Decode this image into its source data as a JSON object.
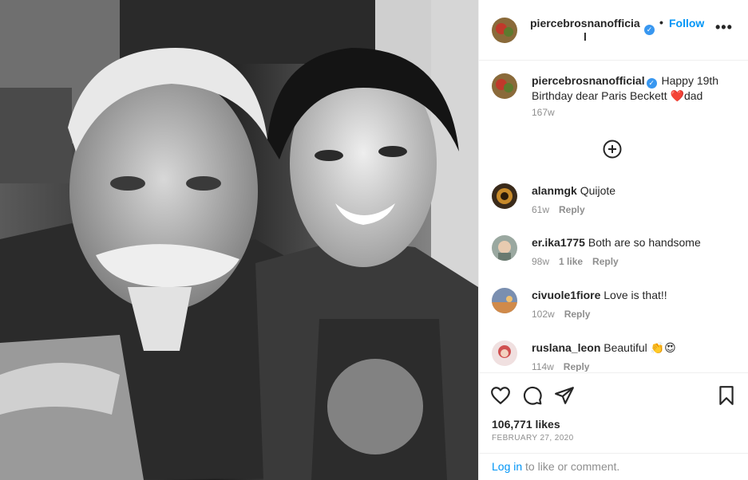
{
  "colors": {
    "accent": "#0095f6",
    "verified": "#3897f0",
    "muted": "#8e8e8e",
    "text": "#262626"
  },
  "post": {
    "photo_description_icon": "photo-image"
  },
  "header": {
    "username_line1": "piercebrosnanofficia",
    "username_line2": "l",
    "verified_icon": "verified-badge-icon",
    "dot": "•",
    "follow_label": "Follow",
    "more_icon": "more-options-icon"
  },
  "caption": {
    "username": "piercebrosnanofficial",
    "text": " Happy 19th Birthday dear Paris Beckett ❤️dad",
    "time": "167w"
  },
  "comments": [
    {
      "username": "alanmgk",
      "text": "Quijote",
      "time": "61w",
      "likes": "",
      "reply": "Reply"
    },
    {
      "username": "er.ika1775",
      "text": "Both are so handsome",
      "time": "98w",
      "likes": "1 like",
      "reply": "Reply"
    },
    {
      "username": "civuole1fiore",
      "text": "Love is that!!",
      "time": "102w",
      "likes": "",
      "reply": "Reply"
    },
    {
      "username": "ruslana_leon",
      "text": "Beautiful 👏😍",
      "time": "114w",
      "likes": "",
      "reply": "Reply"
    }
  ],
  "actions": {
    "likes": "106,771 likes",
    "date": "FEBRUARY 27, 2020"
  },
  "login": {
    "link": "Log in",
    "rest": " to like or comment."
  }
}
